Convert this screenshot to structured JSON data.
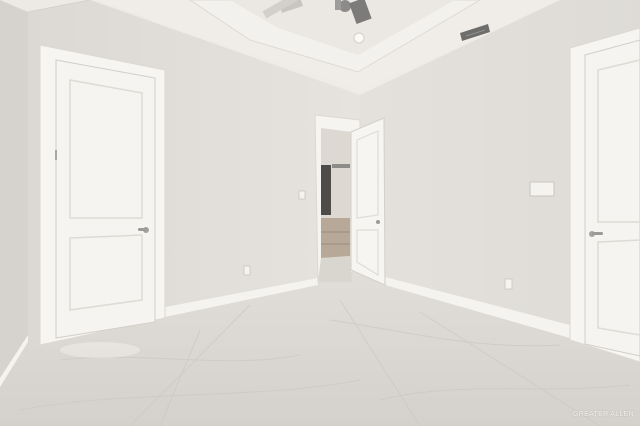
{
  "photo": {
    "subject": "empty-bedroom",
    "watermark": "GREATER ALLEN"
  },
  "colors": {
    "wall": "#e6e3df",
    "wall_shadow": "#d8d5d1",
    "ceiling": "#efece8",
    "trim": "#f7f6f3",
    "door": "#f5f4f1",
    "floor": "#dcd9d4",
    "floor_vein": "#c9c5bf",
    "hardware": "#9a9a98"
  },
  "icons": {
    "ceiling_fan": "ceiling-fan-icon",
    "recessed_light": "recessed-light-icon",
    "air_vent": "air-vent-icon",
    "outlet": "outlet-icon",
    "light_switch": "light-switch-icon",
    "door_handle": "door-handle-icon"
  }
}
